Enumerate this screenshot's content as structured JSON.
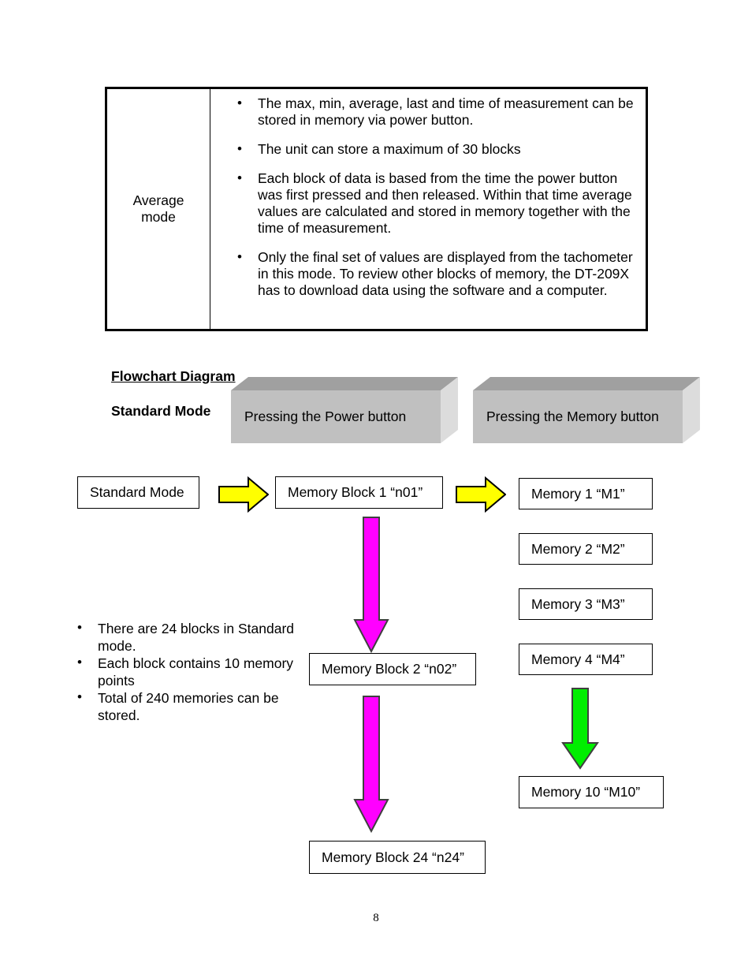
{
  "table": {
    "row_label": "Average\nmode",
    "row_label_line1": "Average",
    "row_label_line2": "mode",
    "bullets": [
      "The max, min, average, last and time of measurement can be stored in memory via power button.",
      "The unit can store a maximum of 30 blocks",
      "Each block of data is based from the time the power button was first pressed and then released.  Within that time average values are calculated and stored in memory together with the time of measurement.",
      "Only the final set of values are displayed from the tachometer in this mode.  To review other blocks of memory, the DT-209X has to download data using the software and a computer."
    ]
  },
  "headings": {
    "flowchart": "Flowchart Diagram",
    "standard_mode": "Standard Mode"
  },
  "banners": [
    {
      "label": "Pressing the Power button"
    },
    {
      "label": "Pressing the Memory button"
    }
  ],
  "flow_boxes": {
    "standard_mode": "Standard Mode",
    "block_1": "Memory Block 1 “n01”",
    "block_2": "Memory Block 2 “n02”",
    "block_24": "Memory Block 24 “n24”",
    "memory_1": "Memory 1 “M1”",
    "memory_2": "Memory 2 “M2”",
    "memory_3": "Memory 3 “M3”",
    "memory_4": "Memory 4 “M4”",
    "memory_10": "Memory 10 “M10”"
  },
  "arrows": {
    "yellow_color": "#FFFF00",
    "magenta_color": "#FF00FF",
    "green_color": "#00EE00",
    "outline_color": "#3F3F3F"
  },
  "notes": [
    "There are 24 blocks in Standard mode.",
    "Each block contains 10 memory points",
    "Total of 240 memories can be stored."
  ],
  "page_number": "8"
}
